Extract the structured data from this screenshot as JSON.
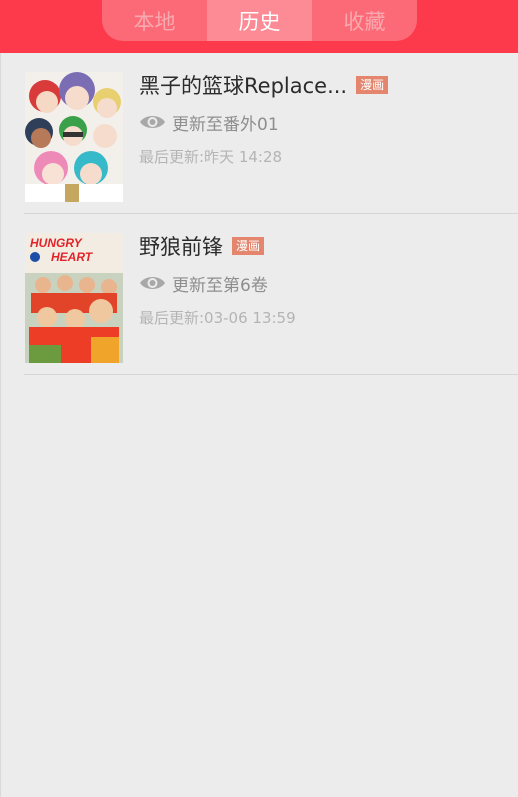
{
  "header": {
    "tabs": [
      {
        "label": "本地",
        "active": false
      },
      {
        "label": "历史",
        "active": true
      },
      {
        "label": "收藏",
        "active": false
      }
    ],
    "accent_color": "#fc3a4c"
  },
  "history": [
    {
      "title": "黑子的篮球Replace...",
      "badge": "漫画",
      "update": "更新至番外01",
      "last_update": "最后更新:昨天 14:28",
      "cover_icon": "kuroko-cover-art"
    },
    {
      "title": "野狼前锋",
      "badge": "漫画",
      "update": "更新至第6卷",
      "last_update": "最后更新:03-06 13:59",
      "cover_icon": "hungry-heart-cover-art",
      "cover_text": "HUNGRY HEART"
    }
  ]
}
